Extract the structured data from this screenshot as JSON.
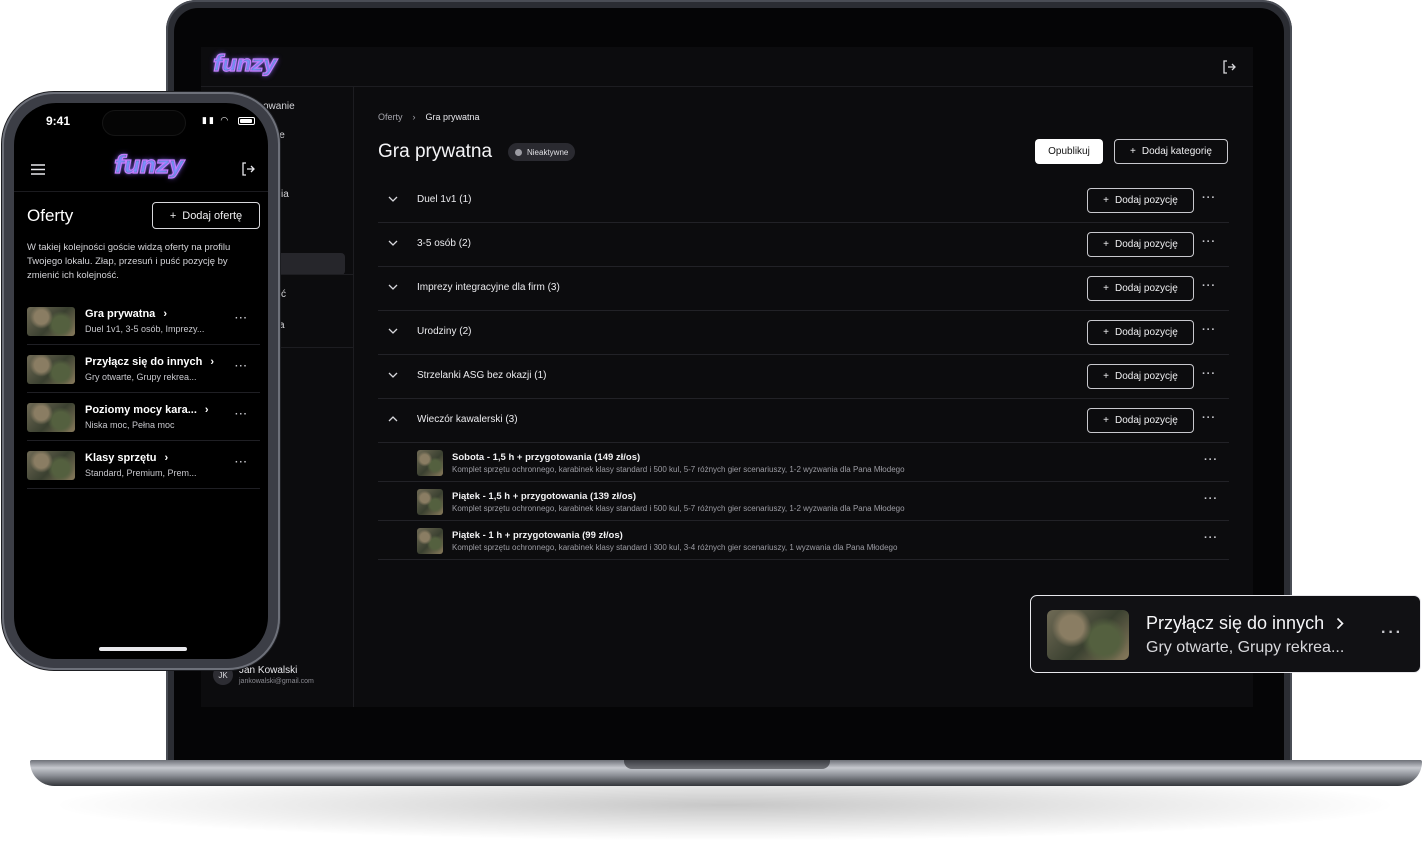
{
  "laptop": {
    "logo": "funzy",
    "sidebar": {
      "items": [
        "owanie",
        "ie",
        "ia",
        "ć",
        "a"
      ],
      "user": {
        "initials": "JK",
        "name": "Jan Kowalski",
        "email": "jankowalski@gmail.com"
      }
    },
    "breadcrumb": [
      "Oferty",
      "Gra prywatna"
    ],
    "page_title": "Gra prywatna",
    "status_badge": "Nieaktywne",
    "publish_label": "Opublikuj",
    "add_category_label": "Dodaj kategorię",
    "add_position_label": "Dodaj pozycję",
    "categories": [
      {
        "label": "Duel 1v1 (1)",
        "expanded": false
      },
      {
        "label": "3-5 osób (2)",
        "expanded": false
      },
      {
        "label": "Imprezy integracyjne dla firm (3)",
        "expanded": false
      },
      {
        "label": "Urodziny (2)",
        "expanded": false
      },
      {
        "label": "Strzelanki ASG bez okazji (1)",
        "expanded": false
      },
      {
        "label": "Wieczór kawalerski (3)",
        "expanded": true
      }
    ],
    "items": [
      {
        "title": "Sobota - 1,5 h + przygotowania (149 zł/os)",
        "desc": "Komplet sprzętu ochronnego, karabinek klasy standard i 500 kul, 5-7 różnych gier scenariuszy, 1-2 wyzwania dla Pana Młodego"
      },
      {
        "title": "Piątek - 1,5 h + przygotowania (139 zł/os)",
        "desc": "Komplet sprzętu ochronnego, karabinek klasy standard i 500 kul, 5-7 różnych gier scenariuszy, 1-2 wyzwania dla Pana Młodego"
      },
      {
        "title": "Piątek - 1 h + przygotowania (99 zł/os)",
        "desc": "Komplet sprzętu ochronnego, karabinek klasy standard i 300 kul, 3-4 różnych gier scenariuszy, 1 wyzwania dla Pana Młodego"
      }
    ]
  },
  "floating_card": {
    "title": "Przyłącz się do innych",
    "subtitle": "Gry otwarte, Grupy rekrea..."
  },
  "phone": {
    "time": "9:41",
    "logo": "funzy",
    "title": "Oferty",
    "add_offer_label": "Dodaj ofertę",
    "info": "W takiej kolejności goście widzą oferty na profilu Twojego lokalu. Złap, przesuń i puść pozycję by zmienić ich kolejność.",
    "offers": [
      {
        "title": "Gra prywatna",
        "subtitle": "Duel 1v1, 3-5 osób, Imprezy..."
      },
      {
        "title": "Przyłącz się do innych",
        "subtitle": "Gry otwarte, Grupy rekrea..."
      },
      {
        "title": "Poziomy mocy kara...",
        "subtitle": "Niska moc, Pełna moc"
      },
      {
        "title": "Klasy sprzętu",
        "subtitle": "Standard, Premium, Prem..."
      }
    ]
  },
  "colors": {
    "background": "#0c0c0e",
    "accent_logo": "#c87bff",
    "border": "#222227"
  }
}
